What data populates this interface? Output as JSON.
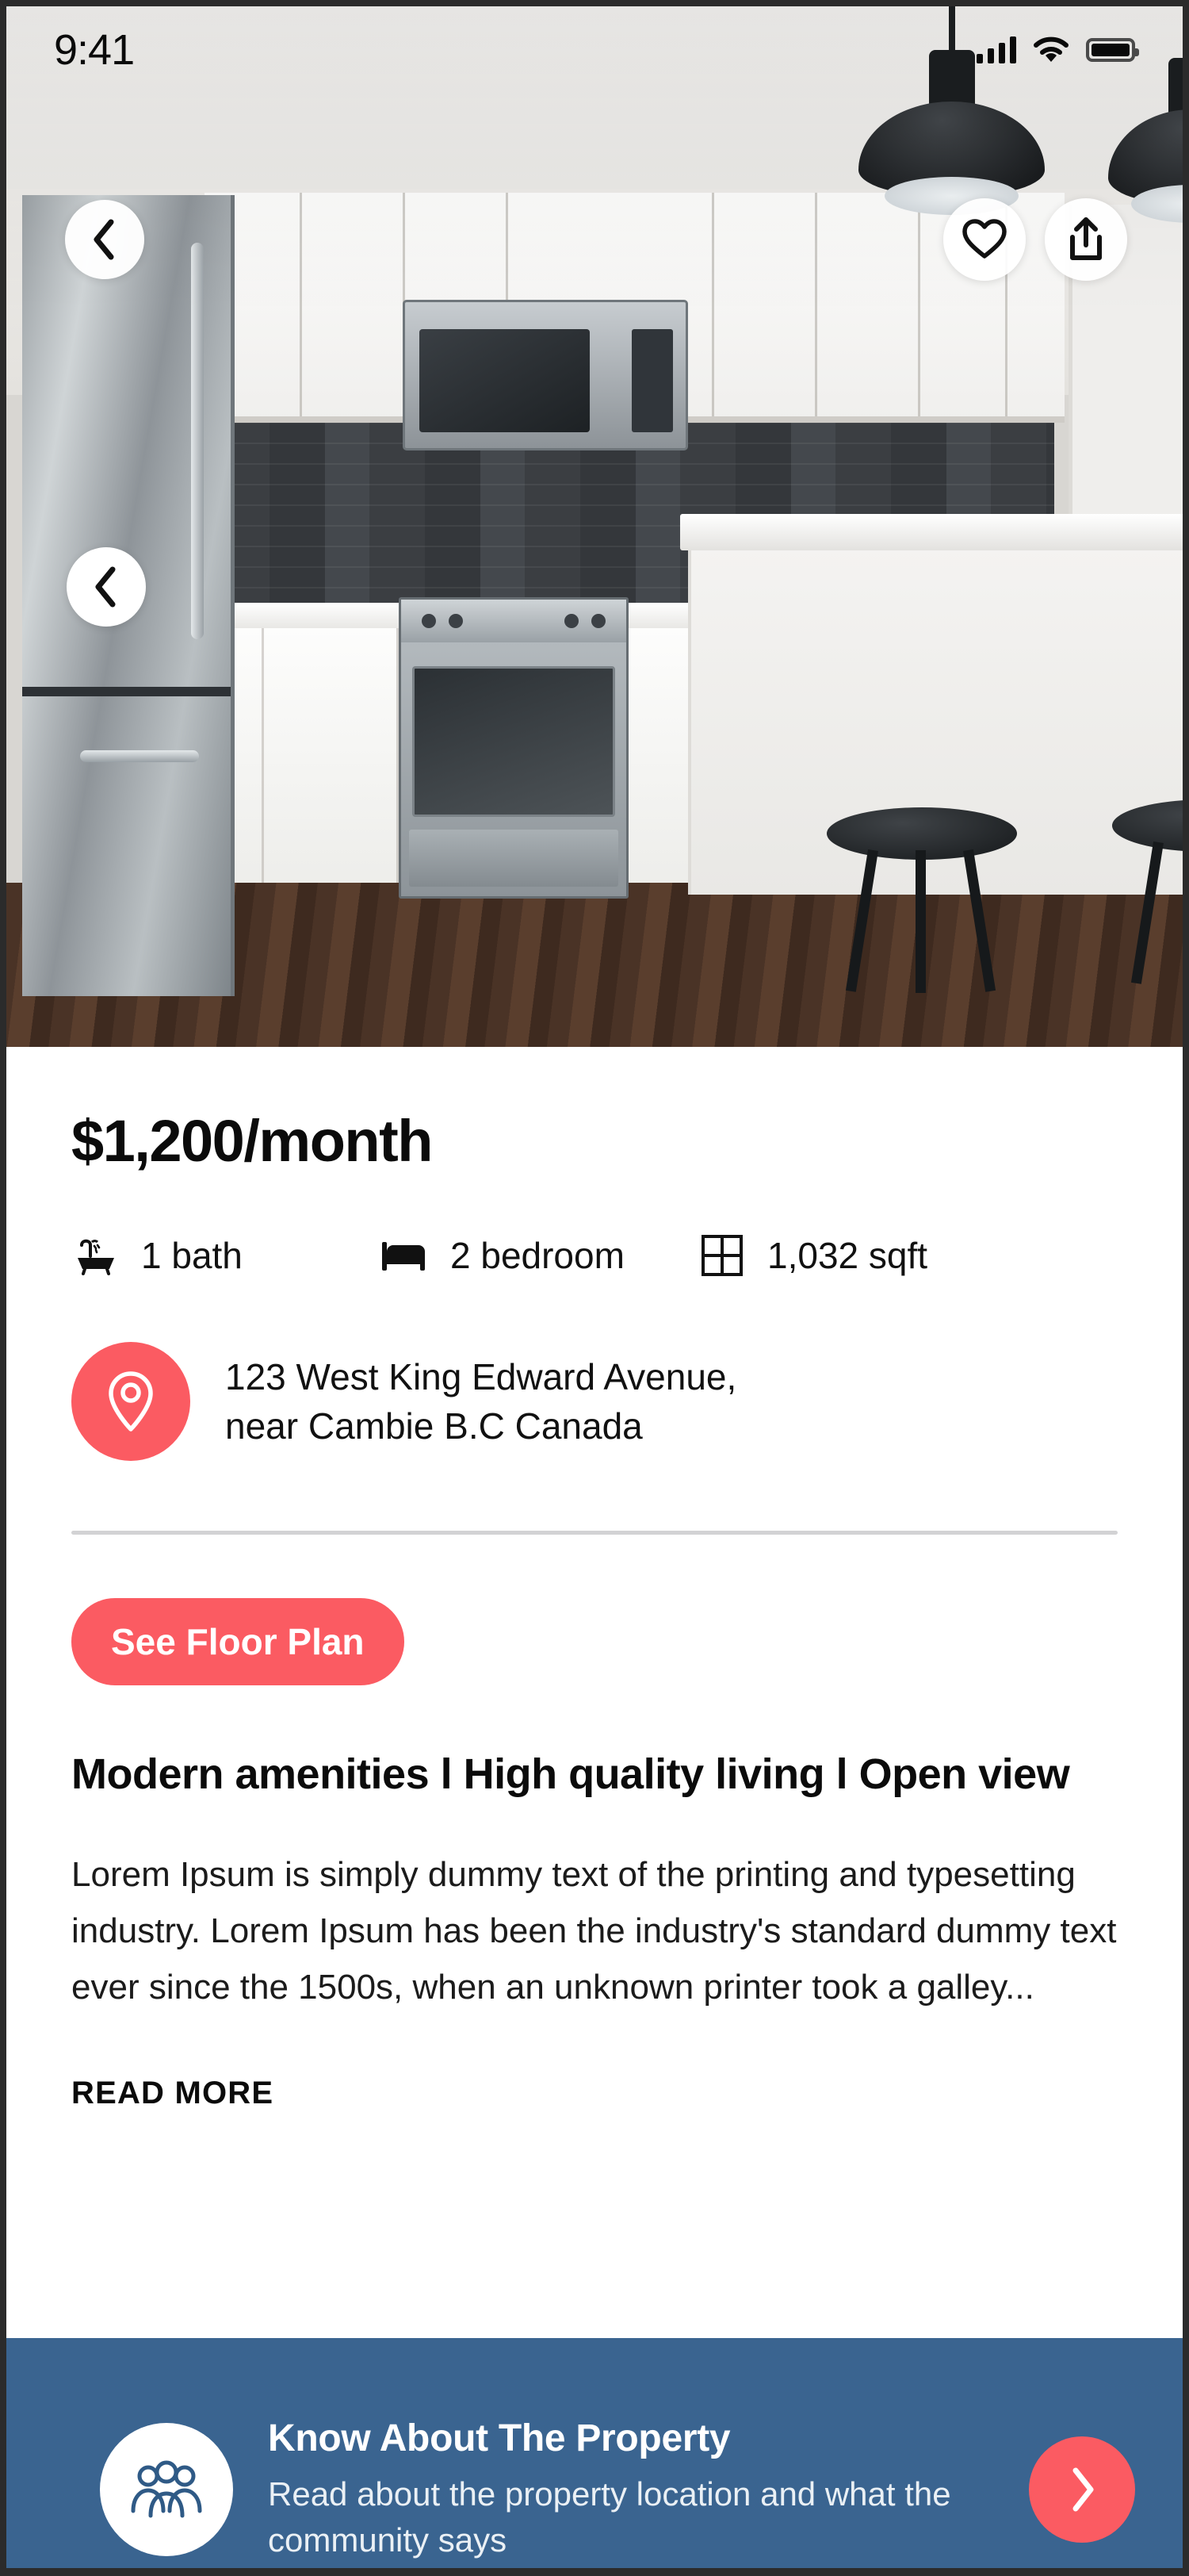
{
  "status_bar": {
    "time": "9:41",
    "signal_icon": "cellular-signal-icon",
    "wifi_icon": "wifi-icon",
    "battery_icon": "battery-full-icon"
  },
  "hero": {
    "photo_description": "Modern kitchen with stainless steel appliances, white cabinets, dark tile backsplash, white island and black bar stools",
    "back_icon": "chevron-left-icon",
    "favorite_icon": "heart-outline-icon",
    "share_icon": "share-upload-icon",
    "carousel_prev_icon": "chevron-left-icon"
  },
  "listing": {
    "price": "$1,200/month",
    "specs": [
      {
        "icon": "bathtub-icon",
        "label": "1 bath"
      },
      {
        "icon": "bed-icon",
        "label": "2 bedroom"
      },
      {
        "icon": "area-grid-icon",
        "label": "1,032 sqft"
      }
    ],
    "address": {
      "icon": "map-pin-icon",
      "line1": "123 West King Edward Avenue,",
      "line2": "near Cambie B.C Canada"
    },
    "floor_plan_button": "See Floor Plan",
    "headline": "Modern amenities l High quality living l Open view",
    "description": "Lorem Ipsum is simply dummy text of the printing and typesetting industry. Lorem Ipsum has been the industry's standard dummy text ever since the 1500s, when an unknown printer took a galley...",
    "read_more": "READ MORE"
  },
  "banner": {
    "icon": "people-group-icon",
    "title": "Know About The Property",
    "subtitle": "Read about the property location and what the community says",
    "arrow_icon": "chevron-right-icon"
  },
  "colors": {
    "accent": "#FB5B62",
    "banner_bg": "#3A6490",
    "text_primary": "#0B0B0B",
    "divider": "#D2D2D4"
  }
}
